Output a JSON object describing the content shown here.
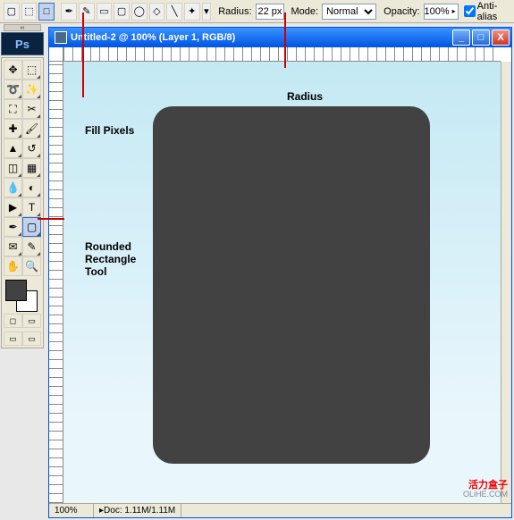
{
  "options": {
    "radius_label": "Radius:",
    "radius_value": "22 px",
    "mode_label": "Mode:",
    "mode_value": "Normal",
    "opacity_label": "Opacity:",
    "opacity_value": "100%",
    "antialias_label": "Anti-alias"
  },
  "app": {
    "logo": "Ps"
  },
  "window": {
    "title": "Untitled-2 @ 100% (Layer 1, RGB/8)",
    "min": "_",
    "max": "□",
    "close": "X"
  },
  "annotations": {
    "fill_pixels": "Fill Pixels",
    "radius": "Radius",
    "rrect_tool": "Rounded Rectangle Tool"
  },
  "status": {
    "zoom": "100%",
    "doc": "Doc: 1.11M/1.11M"
  },
  "watermark": {
    "cn": "活力盒子",
    "en": "OLiHE.COM"
  }
}
